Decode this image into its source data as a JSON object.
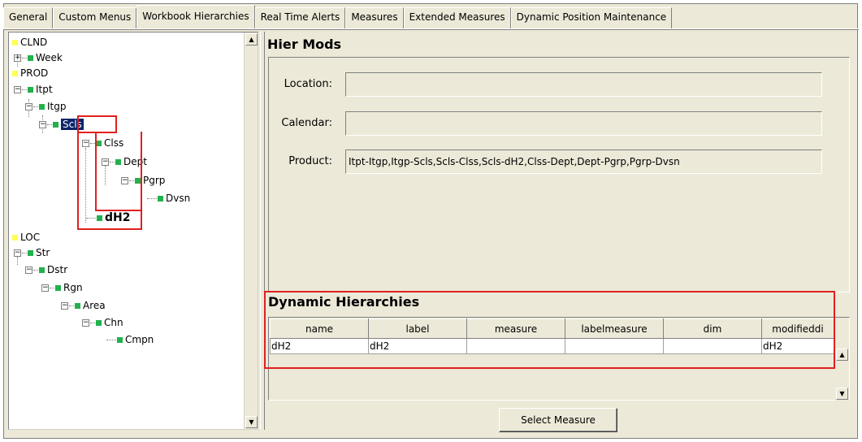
{
  "tabs": [
    {
      "label": "General"
    },
    {
      "label": "Custom Menus"
    },
    {
      "label": "Workbook Hierarchies",
      "active": true
    },
    {
      "label": "Real Time Alerts"
    },
    {
      "label": "Measures"
    },
    {
      "label": "Extended Measures"
    },
    {
      "label": "Dynamic Position Maintenance"
    }
  ],
  "tree": {
    "nodes": [
      "CLND",
      "Week",
      "PROD",
      "Itpt",
      "Itgp",
      "Scls",
      "Clss",
      "Dept",
      "Pgrp",
      "Dvsn",
      "dH2",
      "LOC",
      "Str",
      "Dstr",
      "Rgn",
      "Area",
      "Chn",
      "Cmpn"
    ],
    "selected": "Scls",
    "expand_plus": "+",
    "expand_minus": "−"
  },
  "hier_mods": {
    "title": "Hier Mods",
    "location_label": "Location:",
    "location_value": "",
    "calendar_label": "Calendar:",
    "calendar_value": "",
    "product_label": "Product:",
    "product_value": "Itpt-Itgp,Itgp-Scls,Scls-Clss,Scls-dH2,Clss-Dept,Dept-Pgrp,Pgrp-Dvsn"
  },
  "dynamic_hierarchies": {
    "title": "Dynamic Hierarchies",
    "columns": [
      "name",
      "label",
      "measure",
      "labelmeasure",
      "dim",
      "modifieddi"
    ],
    "rows": [
      [
        "dH2",
        "dH2",
        "",
        "",
        "",
        "dH2"
      ]
    ]
  },
  "select_measure_label": "Select Measure",
  "colors": {
    "highlight": "#e02020",
    "selection": "#0a246a",
    "node_green": "#22b14c",
    "node_yellow": "#ffff55"
  }
}
